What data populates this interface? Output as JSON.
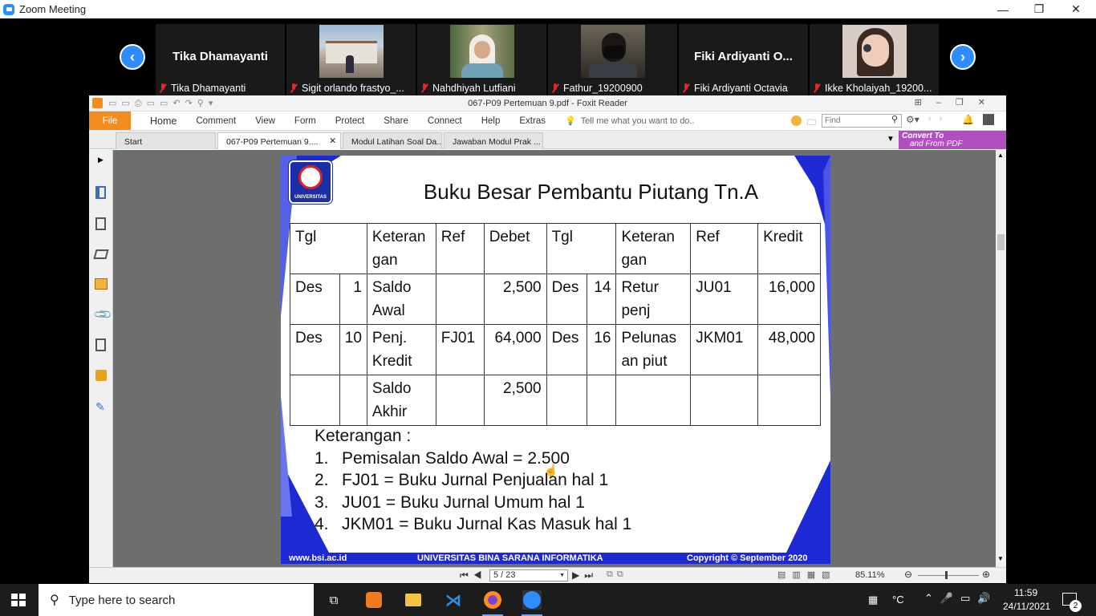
{
  "window": {
    "title": "Zoom Meeting",
    "minimize": "—",
    "restore": "❐",
    "close": "✕"
  },
  "participants": [
    {
      "display": "Tika Dhamayanti",
      "name": "Tika Dhamayanti",
      "has_video": false
    },
    {
      "display": "",
      "name": "Sigit orlando frastyo_...",
      "has_video": true
    },
    {
      "display": "",
      "name": "Nahdhiyah Lutfiani",
      "has_video": true
    },
    {
      "display": "",
      "name": "Fathur_19200900",
      "has_video": true
    },
    {
      "display": "Fiki  Ardiyanti  O...",
      "name": "Fiki Ardiyanti Octavia",
      "has_video": false
    },
    {
      "display": "",
      "name": "Ikke Kholaiyah_19200...",
      "has_video": true
    }
  ],
  "foxit": {
    "title": "067-P09 Pertemuan 9.pdf - Foxit Reader",
    "menu": {
      "file": "File",
      "items": [
        "Home",
        "Comment",
        "View",
        "Form",
        "Protect",
        "Share",
        "Connect",
        "Help",
        "Extras"
      ],
      "tell_me": "Tell me what you want to do..",
      "find_placeholder": "Find"
    },
    "tabs": [
      "Start",
      "067-P09 Pertemuan 9....",
      "Modul Latihan Soal Da...",
      "Jawaban Modul Prak ..."
    ],
    "convert": {
      "line1": "Convert To",
      "line2": "and From PDF"
    },
    "status": {
      "page": "5 / 23",
      "zoom": "85.11%"
    }
  },
  "slide": {
    "logo_text": "UNIVERSITAS",
    "title": "Buku Besar Pembantu Piutang Tn.A",
    "headers": {
      "tgl": "Tgl",
      "keterangan": "Keteran gan",
      "ref": "Ref",
      "debet": "Debet",
      "tgl2": "Tgl",
      "keterangan2": "Keteran gan",
      "ref2": "Ref",
      "kredit": "Kredit"
    },
    "rows": [
      {
        "m": "Des",
        "d": "1",
        "ket": "Saldo Awal",
        "ref": "",
        "debet": "2,500",
        "m2": "Des",
        "d2": "14",
        "ket2": "Retur penj",
        "ref2": "JU01",
        "kredit": "16,000"
      },
      {
        "m": "Des",
        "d": "10",
        "ket": "Penj. Kredit",
        "ref": "FJ01",
        "debet": "64,000",
        "m2": "Des",
        "d2": "16",
        "ket2": "Pelunas an piut",
        "ref2": "JKM01",
        "kredit": "48,000"
      },
      {
        "m": "",
        "d": "",
        "ket": "Saldo Akhir",
        "ref": "",
        "debet": "2,500",
        "m2": "",
        "d2": "",
        "ket2": "",
        "ref2": "",
        "kredit": ""
      }
    ],
    "notes_title": "Keterangan :",
    "notes": [
      {
        "n": "1.",
        "t": "Pemisalan Saldo Awal = 2.500"
      },
      {
        "n": "2.",
        "t": "FJ01 = Buku Jurnal Penjualan hal 1"
      },
      {
        "n": "3.",
        "t": "JU01 = Buku Jurnal Umum hal 1"
      },
      {
        "n": "4.",
        "t": "JKM01 = Buku Jurnal Kas Masuk hal 1"
      }
    ],
    "footer": {
      "left": "www.bsi.ac.id",
      "center": "UNIVERSITAS BINA SARANA INFORMATIKA",
      "right": "Copyright © September 2020"
    }
  },
  "taskbar": {
    "search": "Type here to search",
    "time": "11:59",
    "date": "24/11/2021",
    "temp_unit": "°C",
    "notifications": "2"
  },
  "colors": {
    "zoom_blue": "#2d8cff",
    "foxit_orange": "#f28c1e",
    "slide_blue": "#1d2ad3",
    "convert_purple": "#b24fc0"
  }
}
